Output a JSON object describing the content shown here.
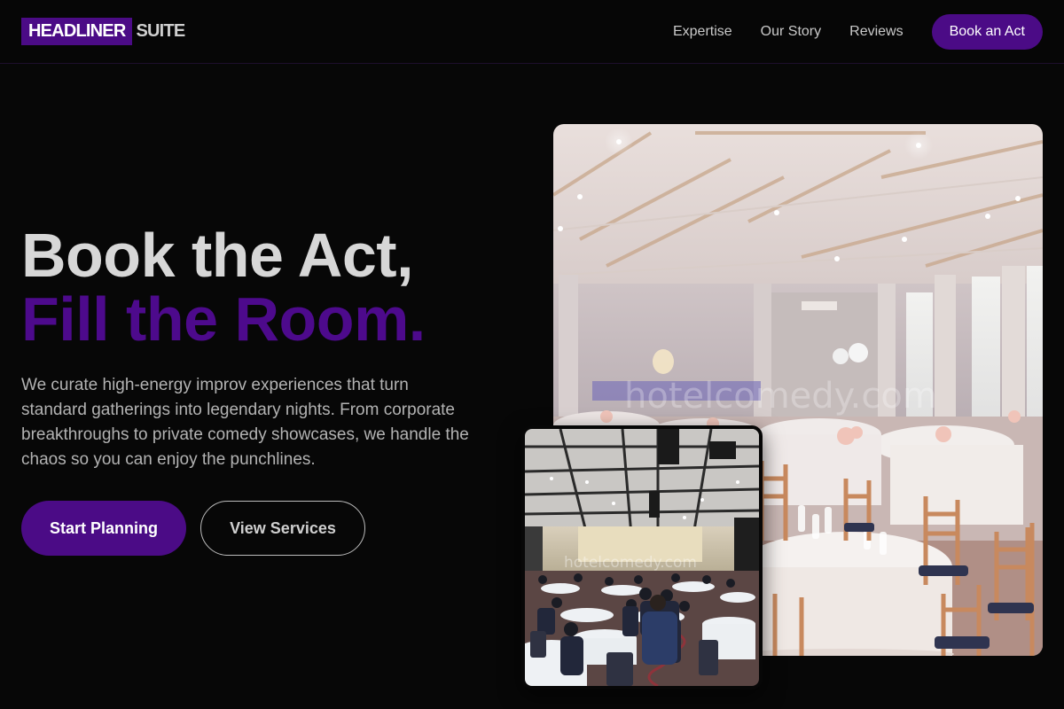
{
  "header": {
    "logo_highlight": "HEADLINER",
    "logo_rest": "SUITE",
    "nav": [
      "Expertise",
      "Our Story",
      "Reviews"
    ],
    "cta": "Book an Act"
  },
  "hero": {
    "title_line1": "Book the Act,",
    "title_line2": "Fill the Room.",
    "description": "We curate high-energy improv experiences that turn standard gatherings into legendary nights. From corporate breakthroughs to private comedy showcases, we handle the chaos so you can enjoy the punchlines.",
    "primary_button": "Start Planning",
    "secondary_button": "View Services"
  },
  "images": {
    "main_watermark": "hotelcomedy.com",
    "small_watermark": "hotelcomedy.com"
  },
  "colors": {
    "accent": "#4b0b86",
    "background": "#070707"
  }
}
